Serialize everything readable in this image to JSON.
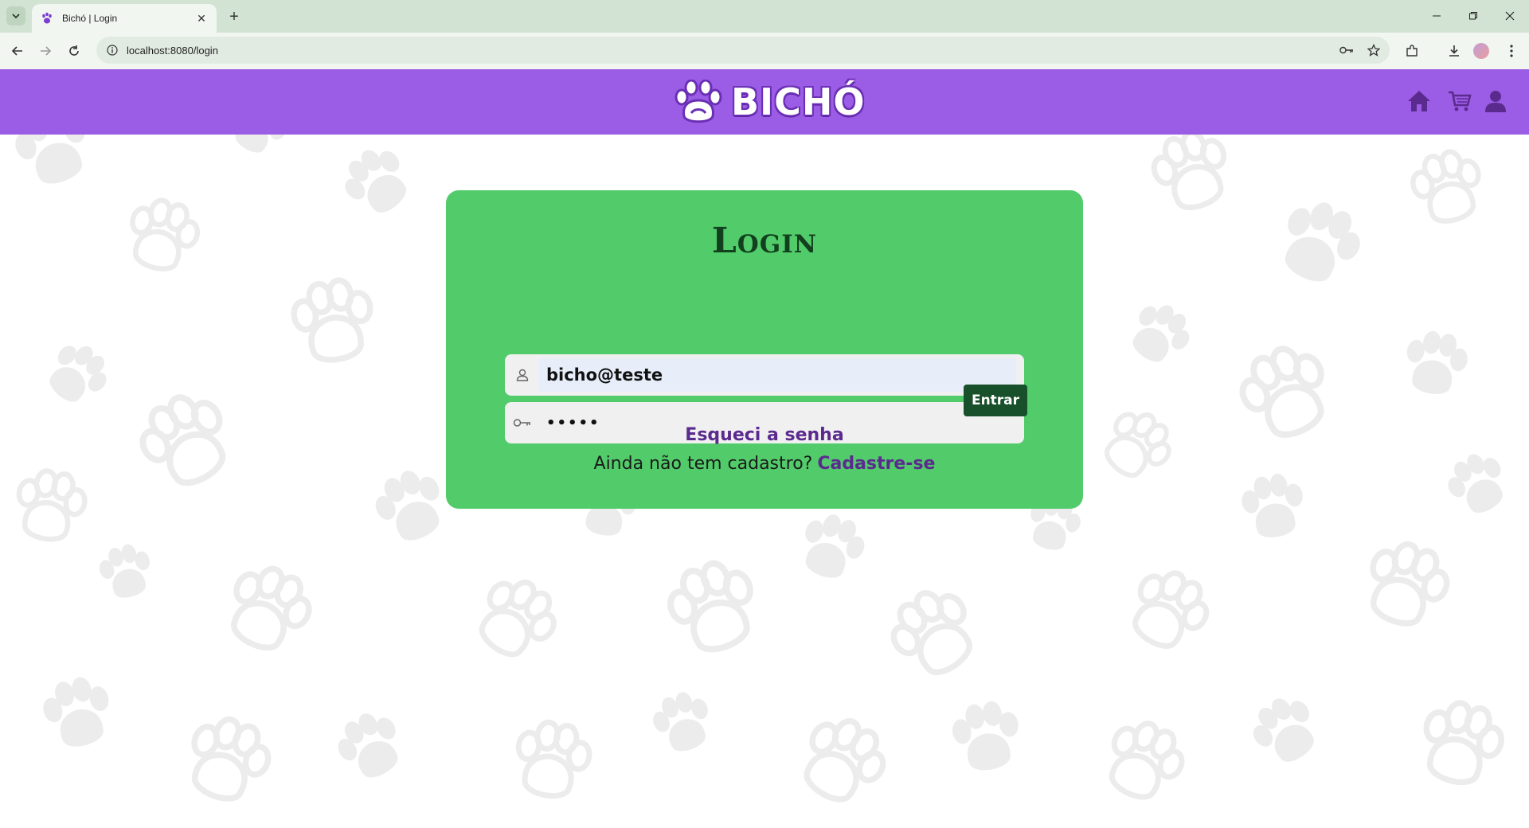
{
  "browser": {
    "tab_title": "Bichó | Login",
    "tab_close": "✕",
    "new_tab": "+",
    "url": "localhost:8080/login"
  },
  "header": {
    "brand": "BICHÓ",
    "icons": [
      "home-icon",
      "cart-icon",
      "user-icon"
    ],
    "color": "#9b5de5"
  },
  "login": {
    "title": "Login",
    "email_value": "bicho@teste",
    "password_value": "•••••",
    "submit_label": "Entrar",
    "forgot_link": "Esqueci a senha",
    "signup_prompt": "Ainda não tem cadastro?",
    "signup_link": "Cadastre-se",
    "card_color": "#52cc6a",
    "button_color": "#17502a",
    "link_color": "#5b2a8f"
  }
}
